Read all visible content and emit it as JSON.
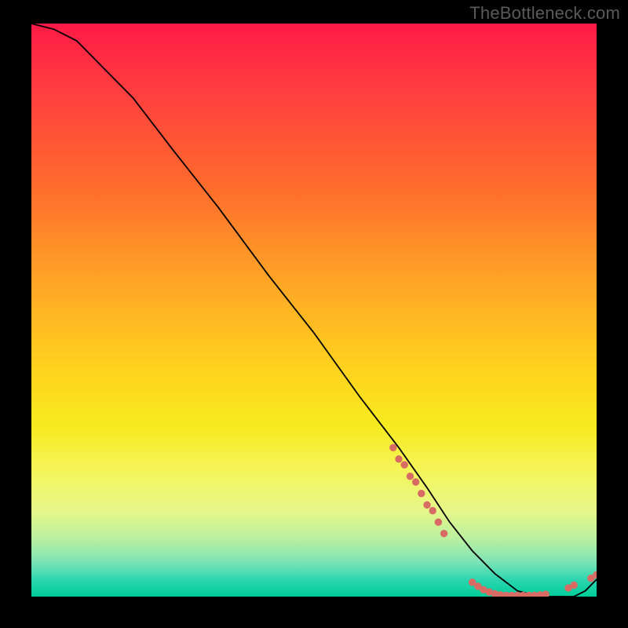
{
  "watermark": "TheBottleneck.com",
  "chart_data": {
    "type": "line",
    "title": "",
    "xlabel": "",
    "ylabel": "",
    "xlim": [
      0,
      100
    ],
    "ylim": [
      0,
      100
    ],
    "grid": false,
    "legend": false,
    "curve": {
      "x": [
        0,
        4,
        8,
        12,
        18,
        25,
        33,
        42,
        50,
        58,
        65,
        70,
        74,
        78,
        82,
        86,
        90,
        93,
        96,
        98,
        100
      ],
      "y": [
        100,
        99,
        97,
        93,
        87,
        78,
        68,
        56,
        46,
        35,
        26,
        19,
        13,
        8,
        4,
        1,
        0,
        0,
        0,
        1,
        3
      ]
    },
    "marker_clusters": [
      {
        "name": "cluster-left",
        "color": "#d86b63",
        "points": [
          {
            "x": 64,
            "y": 26
          },
          {
            "x": 65,
            "y": 24
          },
          {
            "x": 66,
            "y": 23
          },
          {
            "x": 67,
            "y": 21
          },
          {
            "x": 68,
            "y": 20
          },
          {
            "x": 69,
            "y": 18
          },
          {
            "x": 70,
            "y": 16
          },
          {
            "x": 71,
            "y": 15
          },
          {
            "x": 72,
            "y": 13
          },
          {
            "x": 73,
            "y": 11
          }
        ]
      },
      {
        "name": "cluster-bottom",
        "color": "#d86b63",
        "points": [
          {
            "x": 78,
            "y": 2.5
          },
          {
            "x": 79,
            "y": 1.8
          },
          {
            "x": 80,
            "y": 1.2
          },
          {
            "x": 81,
            "y": 0.8
          },
          {
            "x": 82,
            "y": 0.5
          },
          {
            "x": 83,
            "y": 0.3
          },
          {
            "x": 84,
            "y": 0.2
          },
          {
            "x": 85,
            "y": 0.2
          },
          {
            "x": 86,
            "y": 0.2
          },
          {
            "x": 87,
            "y": 0.2
          },
          {
            "x": 88,
            "y": 0.2
          },
          {
            "x": 89,
            "y": 0.2
          },
          {
            "x": 90,
            "y": 0.3
          },
          {
            "x": 91,
            "y": 0.4
          }
        ]
      },
      {
        "name": "cluster-right",
        "color": "#d86b63",
        "points": [
          {
            "x": 95,
            "y": 1.5
          },
          {
            "x": 96,
            "y": 2.0
          },
          {
            "x": 99,
            "y": 3.2
          },
          {
            "x": 100,
            "y": 3.8
          }
        ]
      }
    ],
    "gradient_stops": [
      {
        "pos": 0,
        "color": "#ff1a47"
      },
      {
        "pos": 12,
        "color": "#ff3f3f"
      },
      {
        "pos": 28,
        "color": "#ff6a2d"
      },
      {
        "pos": 45,
        "color": "#ffa526"
      },
      {
        "pos": 60,
        "color": "#ffd21e"
      },
      {
        "pos": 70,
        "color": "#f7ea1e"
      },
      {
        "pos": 78,
        "color": "#f5f55a"
      },
      {
        "pos": 85,
        "color": "#e6f78a"
      },
      {
        "pos": 90,
        "color": "#b9efa0"
      },
      {
        "pos": 94,
        "color": "#7ce3b6"
      },
      {
        "pos": 97,
        "color": "#2dd6b0"
      },
      {
        "pos": 100,
        "color": "#00cc99"
      }
    ]
  }
}
